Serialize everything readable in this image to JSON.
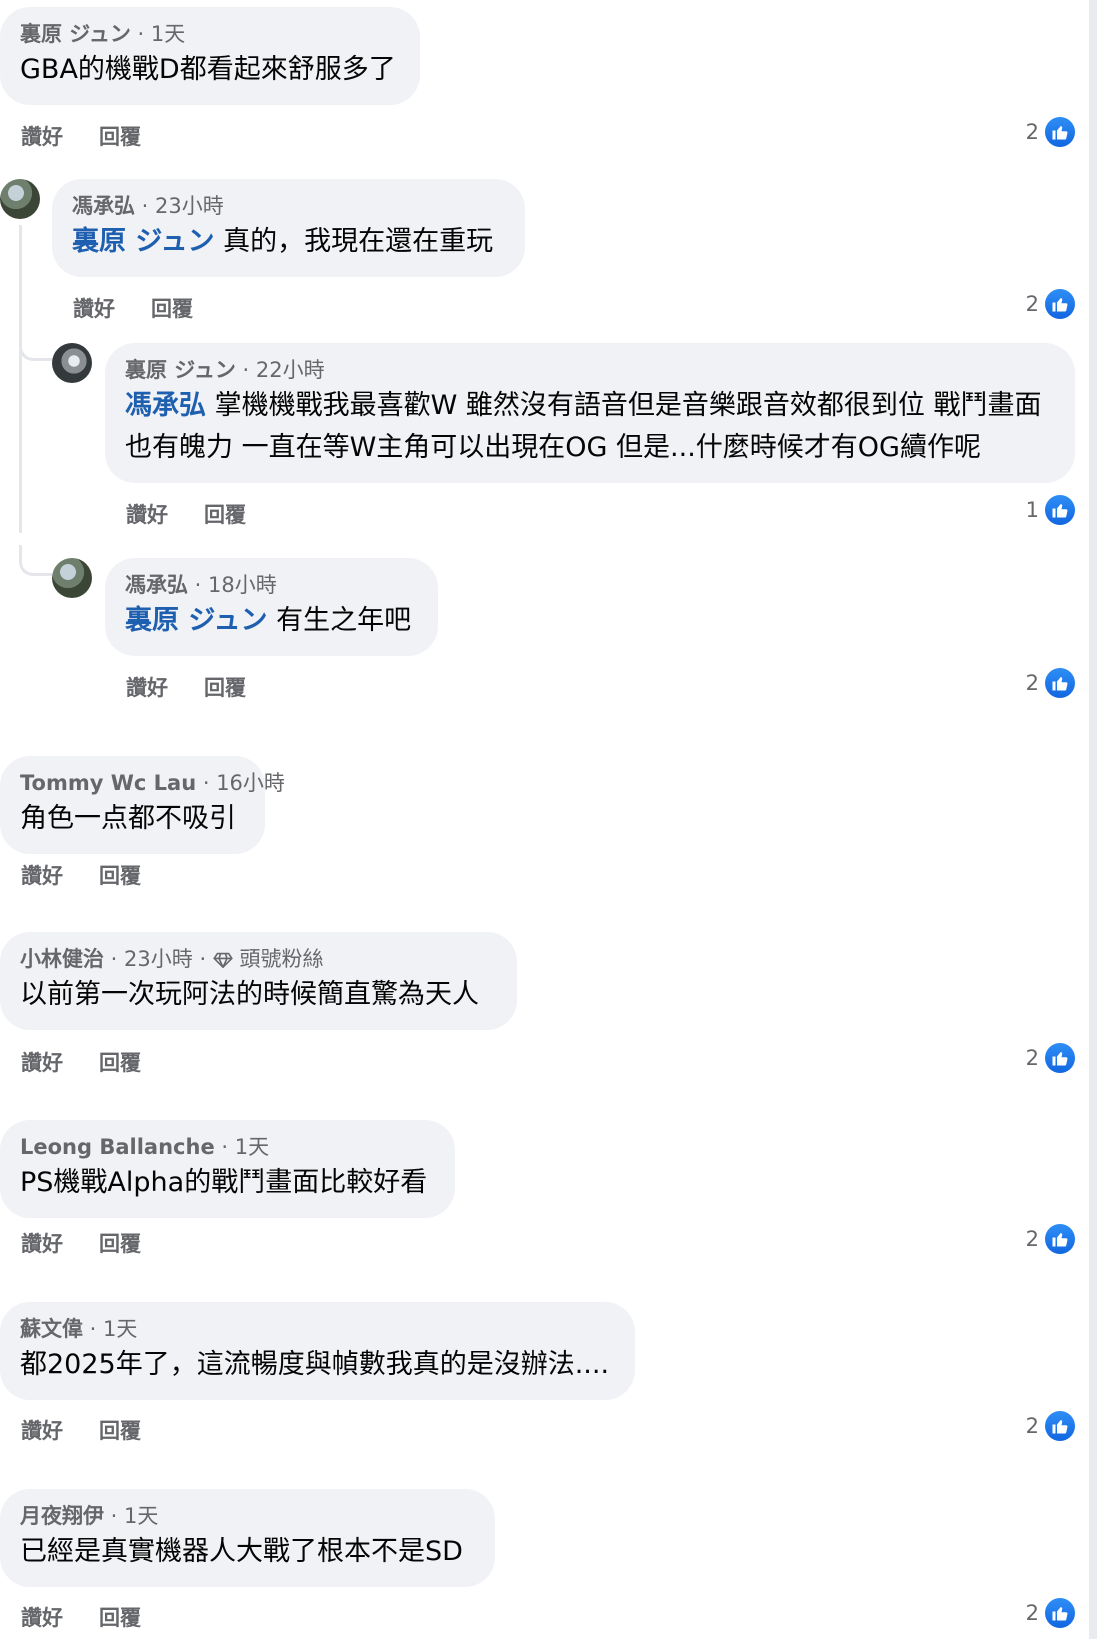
{
  "actions": {
    "like_label": "讚好",
    "reply_label": "回覆"
  },
  "colors": {
    "bubble": "#f0f2f5",
    "mention": "#1f5fb0",
    "like_blue": "#1877f2",
    "meta": "#65676b"
  },
  "comments": [
    {
      "author": "裏原 ジュン",
      "time": "1天",
      "badge": "",
      "mention": "",
      "text": "GBA的機戰D都看起來舒服多了",
      "likes": "2"
    },
    {
      "author": "馮承弘",
      "time": "23小時",
      "badge": "",
      "mention": "裏原 ジュン",
      "text": " 真的，我現在還在重玩",
      "likes": "2",
      "avatar": "photo"
    },
    {
      "author": "裏原 ジュン",
      "time": "22小時",
      "badge": "",
      "mention": "馮承弘",
      "text": " 掌機機戰我最喜歡W 雖然沒有語音但是音樂跟音效都很到位 戰鬥畫面也有魄力 一直在等W主角可以出現在OG 但是...什麼時候才有OG續作呢",
      "likes": "1",
      "avatar": "photo"
    },
    {
      "author": "馮承弘",
      "time": "18小時",
      "badge": "",
      "mention": "裏原 ジュン",
      "text": " 有生之年吧",
      "likes": "2",
      "avatar": "photo"
    },
    {
      "author": "Tommy Wc Lau",
      "time": "16小時",
      "badge": "",
      "mention": "",
      "text": "角色一点都不吸引",
      "likes": ""
    },
    {
      "author": "小林健治",
      "time": "23小時",
      "badge": "頭號粉絲",
      "badge_icon": "diamond-icon",
      "mention": "",
      "text": "以前第一次玩阿法的時候簡直驚為天人",
      "likes": "2"
    },
    {
      "author": "Leong Ballanche",
      "time": "1天",
      "badge": "",
      "mention": "",
      "text": "PS機戰Alpha的戰鬥畫面比較好看",
      "likes": "2"
    },
    {
      "author": "蘇文偉",
      "time": "1天",
      "badge": "",
      "mention": "",
      "text": "都2025年了，這流暢度與幀數我真的是沒辦法....",
      "likes": "2"
    },
    {
      "author": "月夜翔伊",
      "time": "1天",
      "badge": "",
      "mention": "",
      "text": "已經是真實機器人大戰了根本不是SD",
      "likes": "2"
    }
  ]
}
